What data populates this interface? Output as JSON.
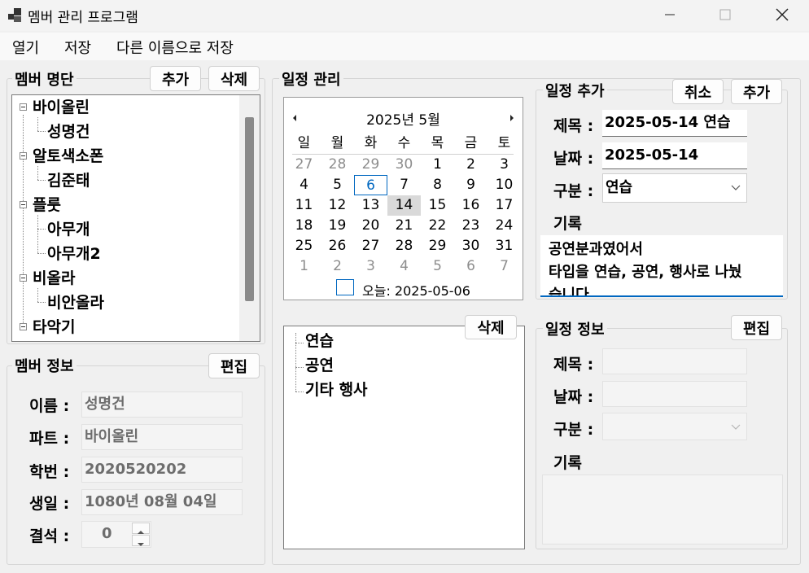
{
  "window": {
    "title": "멤버 관리 프로그램"
  },
  "menu": [
    "열기",
    "저장",
    "다른 이름으로 저장"
  ],
  "member_list": {
    "label": "멤버 명단",
    "add_label": "추가",
    "delete_label": "삭제",
    "tree": [
      {
        "text": "바이올린",
        "level": 0
      },
      {
        "text": "성명건",
        "level": 1
      },
      {
        "text": "알토색소폰",
        "level": 0
      },
      {
        "text": "김준태",
        "level": 1
      },
      {
        "text": "플룻",
        "level": 0
      },
      {
        "text": "아무개",
        "level": 1
      },
      {
        "text": "아무개2",
        "level": 1
      },
      {
        "text": "비올라",
        "level": 0
      },
      {
        "text": "비안올라",
        "level": 1
      },
      {
        "text": "타악기",
        "level": 0
      }
    ]
  },
  "member_info": {
    "label": "멤버 정보",
    "edit_label": "편집",
    "fields": [
      {
        "label": "이름 :",
        "value": "성명건"
      },
      {
        "label": "파트 :",
        "value": "바이올린"
      },
      {
        "label": "학번 :",
        "value": "2020520202"
      },
      {
        "label": "생일 :",
        "value": "1080년 08월 04일"
      }
    ],
    "absence_label": "결석 :",
    "absence_value": "0"
  },
  "schedule": {
    "label": "일정 관리",
    "calendar": {
      "month_title": "2025년 5월",
      "weekdays": [
        "일",
        "월",
        "화",
        "수",
        "목",
        "금",
        "토"
      ],
      "weeks": [
        [
          "27",
          "28",
          "29",
          "30",
          "1",
          "2",
          "3"
        ],
        [
          "4",
          "5",
          "6",
          "7",
          "8",
          "9",
          "10"
        ],
        [
          "11",
          "12",
          "13",
          "14",
          "15",
          "16",
          "17"
        ],
        [
          "18",
          "19",
          "20",
          "21",
          "22",
          "23",
          "24"
        ],
        [
          "25",
          "26",
          "27",
          "28",
          "29",
          "30",
          "31"
        ],
        [
          "1",
          "2",
          "3",
          "4",
          "5",
          "6",
          "7"
        ]
      ],
      "selected": "14",
      "today_marker": "6",
      "today_label": "오늘: 2025-05-06"
    },
    "categories": {
      "delete_label": "삭제",
      "items": [
        "연습",
        "공연",
        "기타 행사"
      ]
    }
  },
  "schedule_add": {
    "label": "일정 추가",
    "cancel_label": "취소",
    "add_label": "추가",
    "title_label": "제목 :",
    "title_value": "2025-05-14 연습",
    "date_label": "날짜 :",
    "date_value": "2025-05-14",
    "type_label": "구분 :",
    "type_value": "연습",
    "record_label": "기록",
    "record_lines": [
      "공연분과였어서",
      "타입을 연습, 공연, 행사로 나눴",
      "습니다"
    ]
  },
  "schedule_info": {
    "label": "일정 정보",
    "edit_label": "편집",
    "title_label": "제목 :",
    "date_label": "날짜 :",
    "type_label": "구분 :",
    "record_label": "기록"
  },
  "colors": {
    "accent": "#0067c0",
    "selected_day_bg": "#d9d9d9",
    "today_border": "#0067c0"
  }
}
